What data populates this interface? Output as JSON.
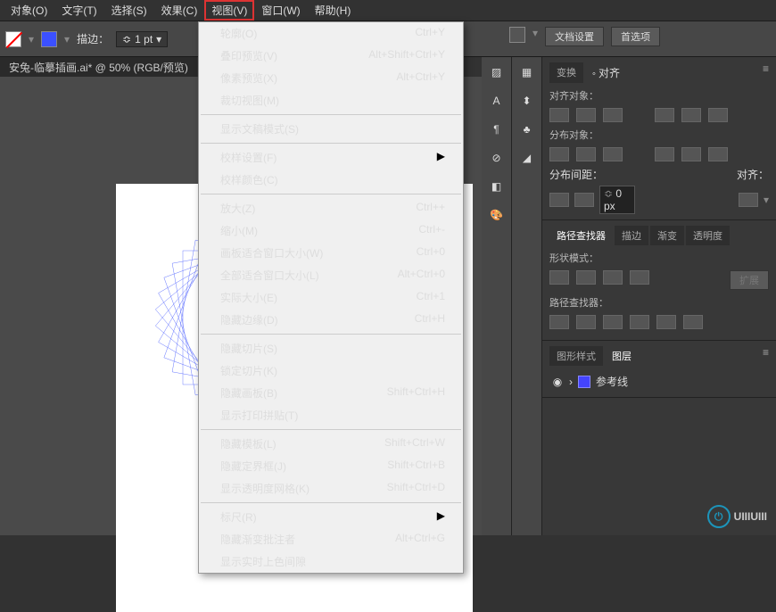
{
  "menubar": {
    "items": [
      "对象(O)",
      "文字(T)",
      "选择(S)",
      "效果(C)",
      "视图(V)",
      "窗口(W)",
      "帮助(H)"
    ],
    "highlighted": "视图(V)"
  },
  "toolbar": {
    "stroke_label": "描边：",
    "stroke_value": "1 pt"
  },
  "topbuttons": {
    "doc_setup": "文档设置",
    "prefs": "首选项"
  },
  "filetab": "安兔-临摹插画.ai* @ 50% (RGB/预览)",
  "view_menu": [
    {
      "l": "轮廓(O)",
      "s": "Ctrl+Y"
    },
    {
      "l": "叠印预览(V)",
      "s": "Alt+Shift+Ctrl+Y"
    },
    {
      "l": "像素预览(X)",
      "s": "Alt+Ctrl+Y"
    },
    {
      "l": "裁切视图(M)",
      "s": ""
    },
    "-",
    {
      "l": "显示文稿模式(S)",
      "s": ""
    },
    "-",
    {
      "l": "校样设置(F)",
      "s": "",
      "sub": true
    },
    {
      "l": "校样颜色(C)",
      "s": ""
    },
    "-",
    {
      "l": "放大(Z)",
      "s": "Ctrl++"
    },
    {
      "l": "缩小(M)",
      "s": "Ctrl+-"
    },
    {
      "l": "画板适合窗口大小(W)",
      "s": "Ctrl+0"
    },
    {
      "l": "全部适合窗口大小(L)",
      "s": "Alt+Ctrl+0"
    },
    {
      "l": "实际大小(E)",
      "s": "Ctrl+1"
    },
    {
      "l": "隐藏边缘(D)",
      "s": "Ctrl+H"
    },
    "-",
    {
      "l": "隐藏切片(S)",
      "s": ""
    },
    {
      "l": "锁定切片(K)",
      "s": ""
    },
    {
      "l": "隐藏画板(B)",
      "s": "Shift+Ctrl+H"
    },
    {
      "l": "显示打印拼贴(T)",
      "s": ""
    },
    "-",
    {
      "l": "隐藏模板(L)",
      "s": "Shift+Ctrl+W",
      "dis": true
    },
    {
      "l": "隐藏定界框(J)",
      "s": "Shift+Ctrl+B"
    },
    {
      "l": "显示透明度网格(K)",
      "s": "Shift+Ctrl+D"
    },
    "-",
    {
      "l": "标尺(R)",
      "s": "",
      "sub": true
    },
    {
      "l": "隐藏渐变批注者",
      "s": "Alt+Ctrl+G"
    },
    {
      "l": "显示实时上色间隙",
      "s": ""
    }
  ],
  "align": {
    "tab1": "变换",
    "tab2": "对齐",
    "sec1": "对齐对象：",
    "sec2": "分布对象：",
    "sec3": "分布间距：",
    "sec4": "对齐：",
    "spacing": "0 px"
  },
  "pathfinder": {
    "tab1": "路径查找器",
    "tab2": "描边",
    "tab3": "渐变",
    "tab4": "透明度",
    "sec1": "形状模式：",
    "sec2": "路径查找器：",
    "expand": "扩展"
  },
  "layers": {
    "tab1": "图形样式",
    "tab2": "图层",
    "item": "参考线"
  },
  "watermark": "UIIIUIII"
}
